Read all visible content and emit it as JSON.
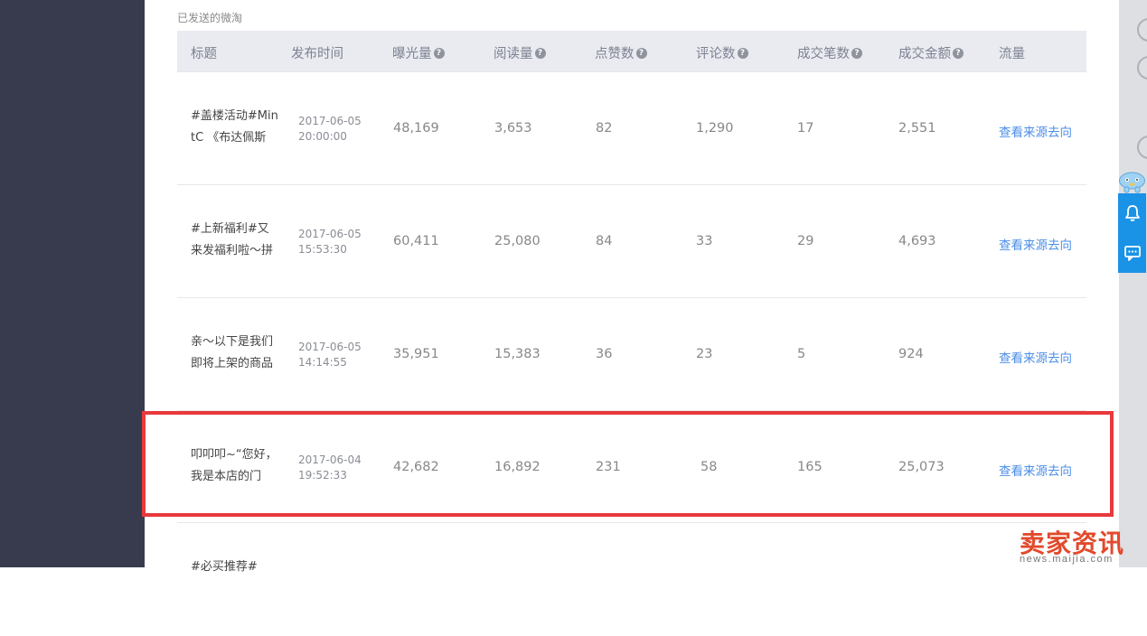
{
  "section_title": "已发送的微淘",
  "columns": [
    {
      "label": "标题",
      "help": false
    },
    {
      "label": "发布时间",
      "help": false
    },
    {
      "label": "曝光量",
      "help": true
    },
    {
      "label": "阅读量",
      "help": true
    },
    {
      "label": "点赞数",
      "help": true
    },
    {
      "label": "评论数",
      "help": true
    },
    {
      "label": "成交笔数",
      "help": true
    },
    {
      "label": "成交金额",
      "help": true
    },
    {
      "label": "流量",
      "help": false
    }
  ],
  "help_glyph": "?",
  "rows": [
    {
      "title_line1": "#盖楼活动#Min",
      "title_line2": "tC 《布达佩斯",
      "date": "2017-06-05",
      "time": "20:00:00",
      "exposure": "48,169",
      "reads": "3,653",
      "likes": "82",
      "comments": "1,290",
      "orders": "17",
      "amount": "2,551",
      "link": "查看来源去向"
    },
    {
      "title_line1": "#上新福利#又",
      "title_line2": "来发福利啦～拼",
      "date": "2017-06-05",
      "time": "15:53:30",
      "exposure": "60,411",
      "reads": "25,080",
      "likes": "84",
      "comments": "33",
      "orders": "29",
      "amount": "4,693",
      "link": "查看来源去向"
    },
    {
      "title_line1": "亲～以下是我们",
      "title_line2": "即将上架的商品",
      "date": "2017-06-05",
      "time": "14:14:55",
      "exposure": "35,951",
      "reads": "15,383",
      "likes": "36",
      "comments": "23",
      "orders": "5",
      "amount": "924",
      "link": "查看来源去向"
    },
    {
      "title_line1": "叩叩叩~“您好，",
      "title_line2": "我是本店的门",
      "date": "2017-06-04",
      "time": "19:52:33",
      "exposure": "42,682",
      "reads": "16,892",
      "likes": "231",
      "comments": "58",
      "orders": "165",
      "amount": "25,073",
      "link": "查看来源去向"
    },
    {
      "title_line1": "#必买推荐#",
      "title_line2": "",
      "date": "",
      "time": "",
      "exposure": "",
      "reads": "",
      "likes": "",
      "comments": "",
      "orders": "",
      "amount": "",
      "link": ""
    }
  ],
  "float_buttons": [
    {
      "icon": "bell-icon"
    },
    {
      "icon": "chat-icon"
    }
  ],
  "watermark": {
    "main": "卖家资讯",
    "sub": "news.maijia.com"
  },
  "colors": {
    "accent": "#1a92e6",
    "link": "#4b8ee8",
    "highlight": "#e8393c",
    "sidebar": "#373b4d",
    "header_bg": "#e9ebf0"
  }
}
